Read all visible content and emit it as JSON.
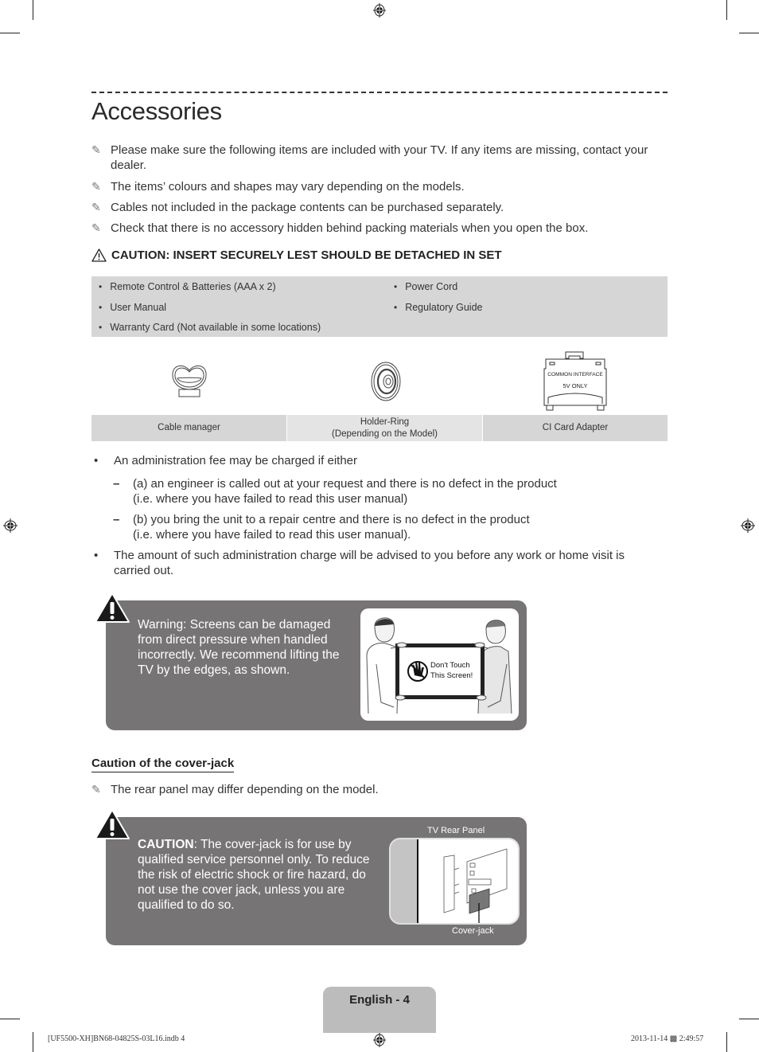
{
  "page": {
    "title": "Accessories",
    "notes": [
      "Please make sure the following items are included with your TV. If any items are missing, contact your dealer.",
      "The items’ colours and shapes may vary depending on the models.",
      "Cables not included in the package contents can be purchased separately.",
      "Check that there is no accessory hidden behind packing materials when you open the box."
    ],
    "note_icon": "pencil-note-icon",
    "caution_heading": "CAUTION: INSERT SECURELY LEST SHOULD BE DETACHED IN SET",
    "caution_icon": "warning-triangle-icon",
    "included_items": {
      "left": [
        "Remote Control & Batteries (AAA x 2)",
        "User Manual",
        "Warranty Card (Not available in some locations)"
      ],
      "right": [
        "Power Cord",
        "Regulatory Guide"
      ]
    },
    "accessories": [
      {
        "label": "Cable manager",
        "label2": ""
      },
      {
        "label": "Holder-Ring",
        "label2": "(Depending on the Model)"
      },
      {
        "label": "CI Card Adapter",
        "label2": ""
      }
    ],
    "ci_card_text": {
      "line1": "COMMON INTERFACE",
      "line2": "5V ONLY"
    },
    "admin_fee": {
      "bullet1": "An administration fee may be charged if either",
      "sub_a_line1": "(a) an engineer is called out at your request and there is no defect in the product",
      "sub_a_line2": "(i.e. where you have failed to read this user manual)",
      "sub_b_line1": "(b) you bring the unit to a repair centre and there is no defect in the product",
      "sub_b_line2": "(i.e. where you have failed to read this user manual).",
      "bullet2": "The amount of such administration charge will be advised to you before any work or home visit is carried out.",
      "dash": "–",
      "dot": "•"
    },
    "warning_box": {
      "text": "Warning: Screens can be damaged from direct pressure when handled incorrectly. We recommend lifting the TV by the edges, as shown.",
      "illustration_sign_line1": "Don't Touch",
      "illustration_sign_line2": "This Screen!"
    },
    "cover_jack_section": {
      "heading": "Caution of the cover-jack",
      "note": "The rear panel may differ depending on the model.",
      "caution_label": "CAUTION",
      "caution_text": ": The cover-jack is for use by qualified service personnel only. To reduce the risk of electric shock or fire hazard, do not use the cover jack, unless you are qualified to do so.",
      "diagram_title": "TV Rear Panel",
      "diagram_callout": "Cover-jack"
    },
    "footer": {
      "page_label": "English - 4",
      "file_slug": "[UF5500-XH]BN68-04825S-03L16.indb   4",
      "timestamp": "2013-11-14   ▩ 2:49:57"
    },
    "colors": {
      "box_gray": "#d6d6d6",
      "warning_box": "#767474",
      "page_tab": "#bcbcbc",
      "text": "#333333"
    }
  }
}
